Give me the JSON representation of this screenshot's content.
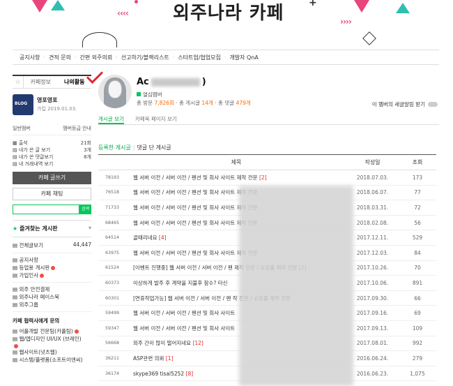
{
  "banner": {
    "title": "외주나라 카페"
  },
  "topnav": [
    "공지사항",
    "견적 문의",
    "간편 외주의뢰",
    "선고하기/블랙리스트",
    "스타트업/협업모집",
    "개발자 QnA"
  ],
  "sidebar": {
    "tabs": [
      "카페정보",
      "나의활동"
    ],
    "profile": {
      "name": "영포영포",
      "joined": "가입 2019.01.03.",
      "logo_text": "BLOG"
    },
    "member_grade": "일반멤버",
    "grade_guide": "멤버등급 안내",
    "stats": [
      {
        "label": "출석",
        "value": "21회"
      },
      {
        "label": "내가 쓴 글 보기",
        "value": "3개"
      },
      {
        "label": "내가 쓴 댓글보기",
        "value": "8개"
      },
      {
        "label": "내 거래내역 보기",
        "value": ""
      }
    ],
    "write_button": "카페 글쓰기",
    "chat_button": "카페 채팅",
    "search_button": "검색",
    "favorites_title": "즐겨찾는 게시판",
    "all_posts": {
      "label": "전체글보기",
      "count": "44,447"
    },
    "menu_group1": [
      "공지사항",
      "등업용 게시판",
      "가입인사"
    ],
    "menu_group2": [
      "외주 안전결제",
      "외주나라 페이스북",
      "외주그룹"
    ],
    "partner_title": "카페 협력사에게 문의",
    "partners": [
      "어플개발 전문팀(카플팀)",
      "웹/앱디자인 UI/UX (브레인)",
      "웹사이트(넛츠웹)",
      "시스템/플랫폼(소프트이엔씨)"
    ]
  },
  "member": {
    "name_prefix": "Ac",
    "name_suffix": ")",
    "grade": "열심멤버",
    "visits_label": "총 방문",
    "visits": "7,826회",
    "posts_label": "총 게시글",
    "posts": "14개",
    "comments_label": "총 댓글",
    "comments": "479개",
    "notify_label": "이 멤버의 새글알림 받기"
  },
  "main_tabs": [
    "게시글 보기",
    "카페북 페이지 보기"
  ],
  "sub_tabs": [
    "등록한 게시글",
    "댓글 단 게시글"
  ],
  "table": {
    "headers": [
      "제목",
      "작성일",
      "조회"
    ],
    "rows": [
      {
        "no": "78193",
        "title": "웹 서버 이전 / 서버 이전 / 펜션 및 회사 사이트 제작 전문",
        "cm": "[2]",
        "date": "2018.07.03.",
        "views": "173"
      },
      {
        "no": "76518",
        "title": "웹 서버 이전 / 서버 이전 / 펜션 및 회사 사이트 제작 전문",
        "cm": "",
        "date": "2018.06.07.",
        "views": "77"
      },
      {
        "no": "71733",
        "title": "웹 서버 이전 / 서버 이전 / 펜션 및 회사 사이트 제작 전문",
        "cm": "",
        "date": "2018.03.31.",
        "views": "72"
      },
      {
        "no": "68465",
        "title": "웹 서버 이전 / 서버 이전 / 펜션 및 회사 사이트 제작 전문",
        "cm": "",
        "date": "2018.02.08.",
        "views": "56"
      },
      {
        "no": "64514",
        "title": "골때리네요",
        "cm": "[4]",
        "date": "2017.12.11.",
        "views": "529"
      },
      {
        "no": "63975",
        "title": "웹 서버 이전 / 서버 이전 / 펜션 및 회사 사이트 제작 전문",
        "cm": "",
        "date": "2017.12.03.",
        "views": "84"
      },
      {
        "no": "61524",
        "title": "[이벤트 진행중] 웹 서버 이전 / 서버 이전 / 펜 제작 전문 / 쇼핑몰 제작 전문",
        "cm": "[2]",
        "date": "2017.10.26.",
        "views": "70"
      },
      {
        "no": "60373",
        "title": "이상하게 발주 후 계약을 지불후 잠수? 타신",
        "cm": "",
        "date": "2017.10.06.",
        "views": "891"
      },
      {
        "no": "60301",
        "title": "[연휴작업가능] 웹 서버 이전 / 서버 이전 / 펜 작 전문 / 쇼핑몰 제작 전문",
        "cm": "",
        "date": "2017.09.30.",
        "views": "66"
      },
      {
        "no": "59499",
        "title": "웹 서버 이전 / 서버 이전 / 펜션 및 회사 사이트",
        "cm": "",
        "date": "2017.09.16.",
        "views": "69"
      },
      {
        "no": "59347",
        "title": "웹 서버 이전 / 서버 이전 / 펜션 및 회사 사이트",
        "cm": "",
        "date": "2017.09.13.",
        "views": "109"
      },
      {
        "no": "56668",
        "title": "외주 간이 많이 떨어지네요",
        "cm": "[12]",
        "date": "2017.08.01.",
        "views": "992"
      },
      {
        "no": "36211",
        "title": "ASP관련 의뢰",
        "cm": "[1]",
        "date": "2016.06.24.",
        "views": "279"
      },
      {
        "no": "36174",
        "title": "skype369 tisal5252",
        "cm": "[8]",
        "date": "2016.06.23.",
        "views": "1,075"
      }
    ]
  }
}
